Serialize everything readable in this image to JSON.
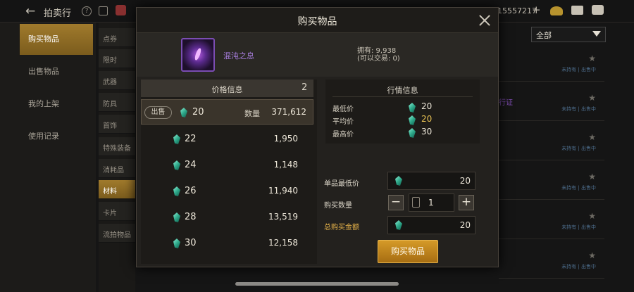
{
  "topbar": {
    "title": "拍卖行",
    "currency": "15557217"
  },
  "left_nav": [
    "购买物品",
    "出售物品",
    "我的上架",
    "使用记录"
  ],
  "sub_nav": [
    "点券",
    "限时",
    "武器",
    "防具",
    "首饰",
    "特殊装备",
    "消耗品",
    "材料",
    "卡片",
    "流拍物品"
  ],
  "filter_dropdown": "全部",
  "background": {
    "status_label": "未持有 | 出售中",
    "accent_text": "行证"
  },
  "modal": {
    "title": "购买物品",
    "item_name": "混沌之息",
    "owned_line1": "拥有: 9,938",
    "owned_line2": "(可以交易: 0)",
    "price_panel": {
      "header": "价格信息",
      "count": "2",
      "sell_badge": "出售",
      "qty_label": "数量",
      "rows": [
        {
          "price": "20",
          "qty": "371,612"
        },
        {
          "price": "22",
          "qty": "1,950"
        },
        {
          "price": "24",
          "qty": "1,148"
        },
        {
          "price": "26",
          "qty": "11,940"
        },
        {
          "price": "28",
          "qty": "13,519"
        },
        {
          "price": "30",
          "qty": "12,158"
        }
      ]
    },
    "market": {
      "title": "行情信息",
      "min_label": "最低价",
      "min": "20",
      "avg_label": "平均价",
      "avg": "20",
      "max_label": "最高价",
      "max": "30"
    },
    "form": {
      "unit_min_label": "单品最低价",
      "unit_min": "20",
      "qty_label": "购买数量",
      "qty": "1",
      "minus": "−",
      "plus": "+",
      "total_label": "总购买金额",
      "total": "20"
    },
    "buy_button": "购买物品"
  },
  "colors": {
    "gold_button": "#d59a28",
    "item_purple": "#a67ddc",
    "gem_green": "#2ea98a",
    "avg_gold": "#e8c254"
  }
}
